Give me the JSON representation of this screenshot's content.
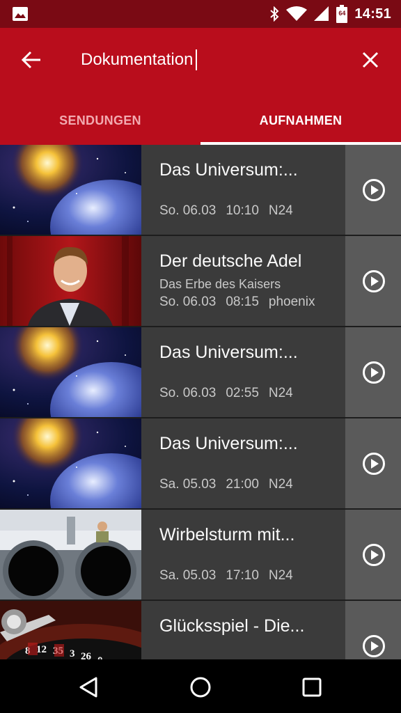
{
  "status": {
    "time": "14:51",
    "battery": "64"
  },
  "search": {
    "query": "Dokumentation"
  },
  "tabs": [
    {
      "label": "SENDUNGEN",
      "active": false
    },
    {
      "label": "AUFNAHMEN",
      "active": true
    }
  ],
  "recordings": [
    {
      "title": "Das Universum:...",
      "subtitle": "",
      "day": "So. 06.03",
      "time": "10:10",
      "channel": "N24",
      "thumb": "space"
    },
    {
      "title": "Der deutsche Adel",
      "subtitle": "Das Erbe des Kaisers",
      "day": "So. 06.03",
      "time": "08:15",
      "channel": "phoenix",
      "thumb": "portrait"
    },
    {
      "title": "Das Universum:...",
      "subtitle": "",
      "day": "So. 06.03",
      "time": "02:55",
      "channel": "N24",
      "thumb": "space"
    },
    {
      "title": "Das Universum:...",
      "subtitle": "",
      "day": "Sa. 05.03",
      "time": "21:00",
      "channel": "N24",
      "thumb": "space"
    },
    {
      "title": "Wirbelsturm mit...",
      "subtitle": "",
      "day": "Sa. 05.03",
      "time": "17:10",
      "channel": "N24",
      "thumb": "jet"
    },
    {
      "title": "Glücksspiel - Die...",
      "subtitle": "",
      "day": "",
      "time": "",
      "channel": "",
      "thumb": "roulette"
    }
  ],
  "colors": {
    "appbar": "#b90d1c",
    "statusbar": "#7a0a14",
    "row": "#3b3b3b",
    "play_column": "#5a5a5a"
  }
}
